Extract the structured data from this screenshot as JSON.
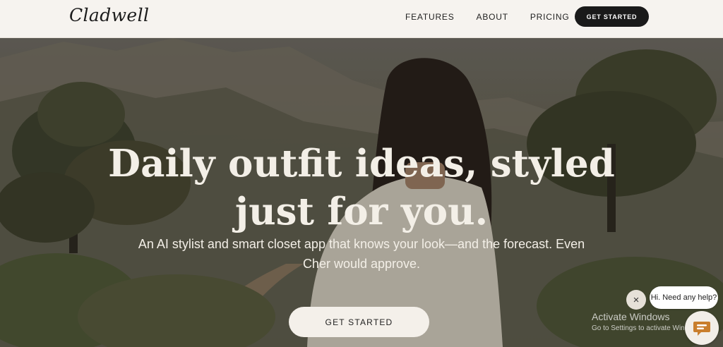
{
  "brand": {
    "logo": "Cladwell"
  },
  "nav": {
    "items": [
      "FEATURES",
      "ABOUT",
      "PRICING"
    ],
    "cta_label": "GET STARTED"
  },
  "hero": {
    "title_lines": [
      "Daily outfit ideas, styled",
      "just for you."
    ],
    "subtitle": "An AI stylist and smart closet app that knows your look—and the forecast. Even Cher would approve.",
    "cta_label": "GET STARTED"
  },
  "chat": {
    "greeting": "Hi. Need any help?",
    "close_icon": "×"
  },
  "watermark": {
    "title": "Activate Windows",
    "subtitle": "Go to Settings to activate Windows."
  },
  "colors": {
    "background": "#f6f3ef",
    "dark_button": "#1a1a1a",
    "hero_text": "#f3efe7",
    "chat_launcher": "#c97e2d"
  }
}
